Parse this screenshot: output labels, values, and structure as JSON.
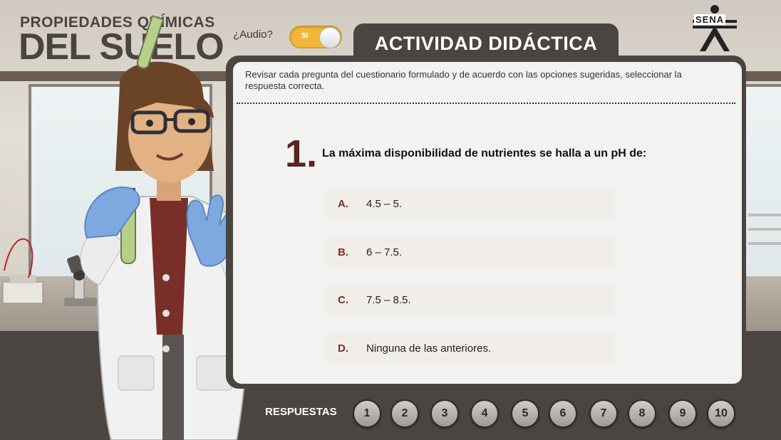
{
  "header": {
    "title_line1": "PROPIEDADES QUÍMICAS",
    "title_line2": "DEL SUELO",
    "audio_label": "¿Audio?",
    "audio_toggle": {
      "state_label": "SI",
      "on": true
    },
    "activity_tab": "ACTIVIDAD DIDÁCTICA",
    "logo_text": "SENA"
  },
  "activity": {
    "instructions": "Revisar cada pregunta del cuestionario formulado y de acuerdo con las opciones sugeridas, seleccionar la respuesta correcta.",
    "question_number": "1.",
    "question_text": "La máxima disponibilidad de nutrientes se halla a un pH de:",
    "options": [
      {
        "letter": "A.",
        "text": "4.5 – 5."
      },
      {
        "letter": "B.",
        "text": "6 – 7.5."
      },
      {
        "letter": "C.",
        "text": "7.5 – 8.5."
      },
      {
        "letter": "D.",
        "text": "Ninguna de las anteriores."
      }
    ]
  },
  "footer": {
    "answers_label": "RESPUESTAS",
    "answer_buttons": [
      "1",
      "2",
      "3",
      "4",
      "5",
      "6",
      "7",
      "8",
      "9",
      "10"
    ]
  },
  "colors": {
    "accent": "#f0b73a",
    "dark_panel": "#4a4541",
    "question_number": "#5a2420",
    "option_letter": "#7a2e28"
  }
}
